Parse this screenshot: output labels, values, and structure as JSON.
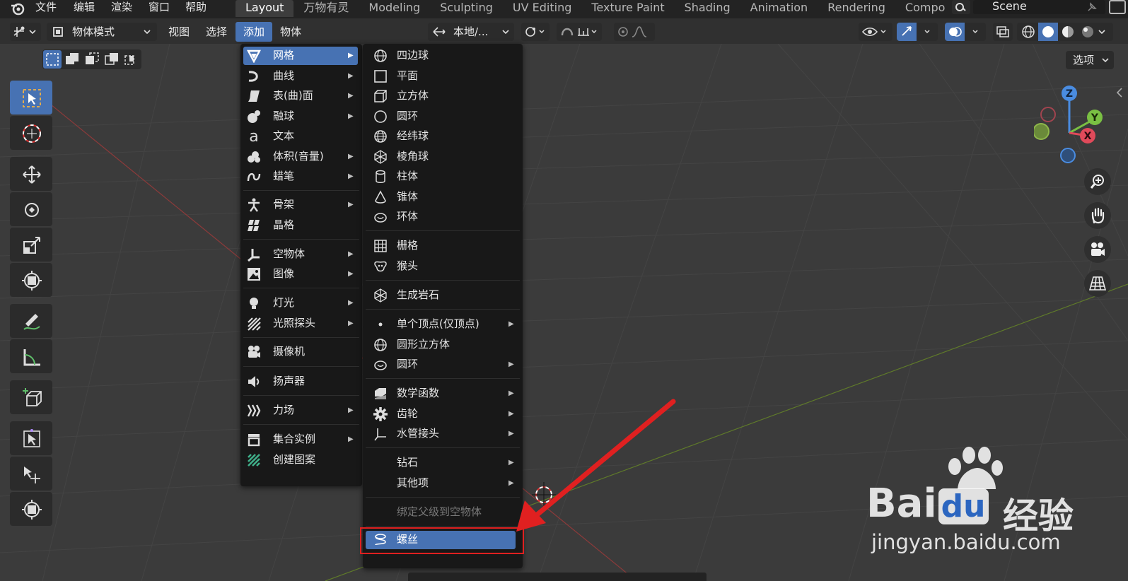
{
  "top_menu": {
    "items": [
      "文件",
      "编辑",
      "渲染",
      "窗口",
      "帮助"
    ]
  },
  "workspace_tabs": [
    "Layout",
    "万物有灵",
    "Modeling",
    "Sculpting",
    "UV Editing",
    "Texture Paint",
    "Shading",
    "Animation",
    "Rendering",
    "Compo"
  ],
  "scene": "Scene",
  "header": {
    "mode": "物体模式",
    "menus": [
      "视图",
      "选择",
      "添加",
      "物体"
    ],
    "orientation": "本地/...",
    "options": "选项"
  },
  "add_menu": {
    "items": [
      {
        "label": "网格",
        "icon": "mesh-icon",
        "submenu": true
      },
      {
        "label": "曲线",
        "icon": "curve-icon",
        "submenu": true
      },
      {
        "label": "表(曲)面",
        "icon": "surface-icon",
        "submenu": true
      },
      {
        "label": "融球",
        "icon": "metaball-icon",
        "submenu": true
      },
      {
        "label": "文本",
        "icon": "text-icon",
        "submenu": false
      },
      {
        "label": "体积(音量)",
        "icon": "volume-icon",
        "submenu": true
      },
      {
        "label": "蜡笔",
        "icon": "grease-pencil-icon",
        "submenu": true
      },
      {
        "label": "骨架",
        "icon": "armature-icon",
        "submenu": true
      },
      {
        "label": "晶格",
        "icon": "lattice-icon",
        "submenu": false
      },
      {
        "label": "空物体",
        "icon": "empty-icon",
        "submenu": true
      },
      {
        "label": "图像",
        "icon": "image-icon",
        "submenu": true
      },
      {
        "label": "灯光",
        "icon": "light-icon",
        "submenu": true
      },
      {
        "label": "光照探头",
        "icon": "light-probe-icon",
        "submenu": true
      },
      {
        "label": "摄像机",
        "icon": "camera-icon",
        "submenu": false
      },
      {
        "label": "扬声器",
        "icon": "speaker-icon",
        "submenu": false
      },
      {
        "label": "力场",
        "icon": "force-field-icon",
        "submenu": true
      },
      {
        "label": "集合实例",
        "icon": "collection-icon",
        "submenu": true
      },
      {
        "label": "创建图案",
        "icon": "pattern-icon",
        "submenu": false
      }
    ]
  },
  "mesh_menu": {
    "items": [
      {
        "label": "四边球",
        "icon": "quad-sphere-icon",
        "submenu": false
      },
      {
        "label": "平面",
        "icon": "plane-icon",
        "submenu": false
      },
      {
        "label": "立方体",
        "icon": "cube-icon",
        "submenu": false
      },
      {
        "label": "圆环",
        "icon": "circle-icon",
        "submenu": false
      },
      {
        "label": "经纬球",
        "icon": "uv-sphere-icon",
        "submenu": false
      },
      {
        "label": "棱角球",
        "icon": "ico-sphere-icon",
        "submenu": false
      },
      {
        "label": "柱体",
        "icon": "cylinder-icon",
        "submenu": false
      },
      {
        "label": "锥体",
        "icon": "cone-icon",
        "submenu": false
      },
      {
        "label": "环体",
        "icon": "torus-icon",
        "submenu": false
      },
      {
        "label": "栅格",
        "icon": "grid-icon",
        "submenu": false
      },
      {
        "label": "猴头",
        "icon": "monkey-icon",
        "submenu": false
      },
      {
        "label": "生成岩石",
        "icon": "rock-icon",
        "submenu": false
      },
      {
        "label": "单个顶点(仅顶点)",
        "icon": "vertex-icon",
        "submenu": true
      },
      {
        "label": "圆形立方体",
        "icon": "round-cube-icon",
        "submenu": false
      },
      {
        "label": "圆环",
        "icon": "torus-icon",
        "submenu": true
      },
      {
        "label": "数学函数",
        "icon": "math-function-icon",
        "submenu": true
      },
      {
        "label": "齿轮",
        "icon": "gear-icon",
        "submenu": true
      },
      {
        "label": "水管接头",
        "icon": "pipe-joint-icon",
        "submenu": true
      },
      {
        "label": "钻石",
        "icon": "",
        "submenu": true
      },
      {
        "label": "其他项",
        "icon": "",
        "submenu": true
      },
      {
        "label": "绑定父级到空物体",
        "icon": "",
        "submenu": false,
        "disabled": true
      },
      {
        "label": "螺丝",
        "icon": "screw-icon",
        "submenu": false,
        "highlighted": true
      }
    ]
  },
  "gizmo": {
    "z": "Z",
    "y": "Y",
    "x": "X"
  },
  "watermark": {
    "brand": "Bai",
    "brand2": "du",
    "cn": "经验",
    "url": "jingyan.baidu.com"
  },
  "colors": {
    "accent": "#4772b3",
    "annotation": "#e02020",
    "menu_bg": "#181818"
  }
}
